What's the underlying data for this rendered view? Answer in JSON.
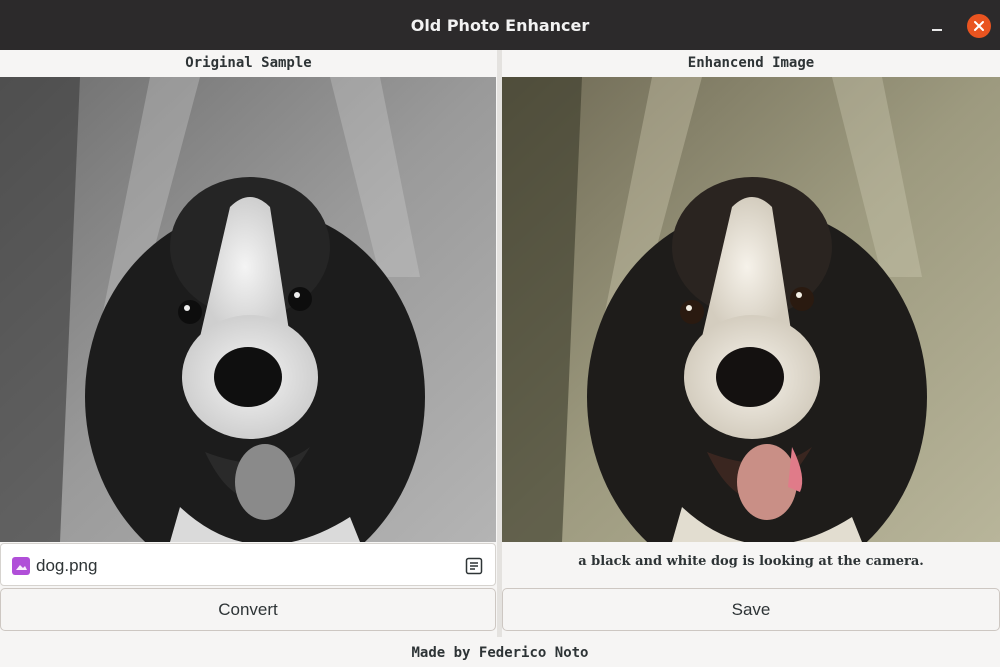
{
  "window": {
    "title": "Old Photo Enhancer"
  },
  "left_panel": {
    "header": "Original Sample",
    "file_name": "dog.png",
    "convert_label": "Convert"
  },
  "right_panel": {
    "header": "Enhancend Image",
    "caption": "a black and white dog is looking at the camera.",
    "save_label": "Save"
  },
  "footer": {
    "credit": "Made by Federico Noto"
  },
  "icons": {
    "minimize": "minimize-icon",
    "close": "close-icon",
    "file": "image-file-icon",
    "file_chooser": "document-icon"
  },
  "colors": {
    "titlebar": "#2c2a2b",
    "close_button": "#e95420",
    "file_icon": "#b04fd8",
    "background": "#f6f5f4"
  }
}
